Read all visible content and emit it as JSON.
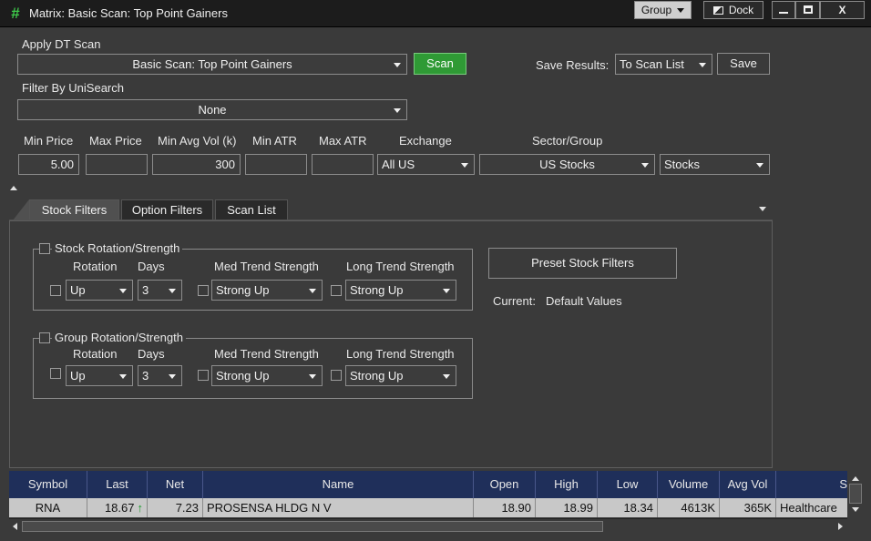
{
  "window": {
    "title": "Matrix: Basic Scan: Top Point Gainers",
    "group_label": "Group",
    "dock_label": "Dock",
    "minimize_glyph": "—",
    "restore_glyph": "□",
    "close_glyph": "X"
  },
  "apply_dt_scan": {
    "label": "Apply DT Scan",
    "selected": "Basic Scan: Top Point Gainers",
    "scan_button": "Scan"
  },
  "save_results": {
    "label": "Save Results:",
    "selected": "To Scan List",
    "save_button": "Save"
  },
  "filter_unisearch": {
    "label": "Filter By UniSearch",
    "selected": "None"
  },
  "criteria": {
    "min_price": {
      "label": "Min Price",
      "value": "5.00"
    },
    "max_price": {
      "label": "Max Price",
      "value": ""
    },
    "min_avg_vol": {
      "label": "Min Avg Vol (k)",
      "value": "300"
    },
    "min_atr": {
      "label": "Min ATR",
      "value": ""
    },
    "max_atr": {
      "label": "Max ATR",
      "value": ""
    },
    "exchange": {
      "label": "Exchange",
      "selected": "All US"
    },
    "sector_group": {
      "label": "Sector/Group",
      "selected": "US Stocks",
      "sub_selected": "Stocks"
    }
  },
  "tabs": [
    {
      "label": "Stock Filters",
      "active": true
    },
    {
      "label": "Option Filters",
      "active": false
    },
    {
      "label": "Scan List",
      "active": false
    }
  ],
  "stock_rotation": {
    "title": "Stock Rotation/Strength",
    "rotation_label": "Rotation",
    "days_label": "Days",
    "med_label": "Med Trend Strength",
    "long_label": "Long Trend Strength",
    "rotation": "Up",
    "days": "3",
    "med": "Strong Up",
    "long": "Strong Up"
  },
  "group_rotation": {
    "title": "Group Rotation/Strength",
    "rotation_label": "Rotation",
    "days_label": "Days",
    "med_label": "Med Trend Strength",
    "long_label": "Long Trend Strength",
    "rotation": "Up",
    "days": "3",
    "med": "Strong Up",
    "long": "Strong Up"
  },
  "preset": {
    "button": "Preset Stock Filters",
    "current_label": "Current:",
    "current_value": "Default Values"
  },
  "table": {
    "columns": [
      "Symbol",
      "Last",
      "Net",
      "Name",
      "Open",
      "High",
      "Low",
      "Volume",
      "Avg Vol",
      "S"
    ],
    "rows": [
      {
        "symbol": "RNA",
        "last": "18.67",
        "net": "7.23",
        "name": "PROSENSA HLDG N V",
        "open": "18.90",
        "high": "18.99",
        "low": "18.34",
        "volume": "4613K",
        "avg_vol": "365K",
        "sector": "Healthcare"
      }
    ]
  },
  "colors": {
    "accent_green": "#2f9a35",
    "header_blue": "#1f2f5a",
    "up_arrow": "#1a9a2a"
  }
}
